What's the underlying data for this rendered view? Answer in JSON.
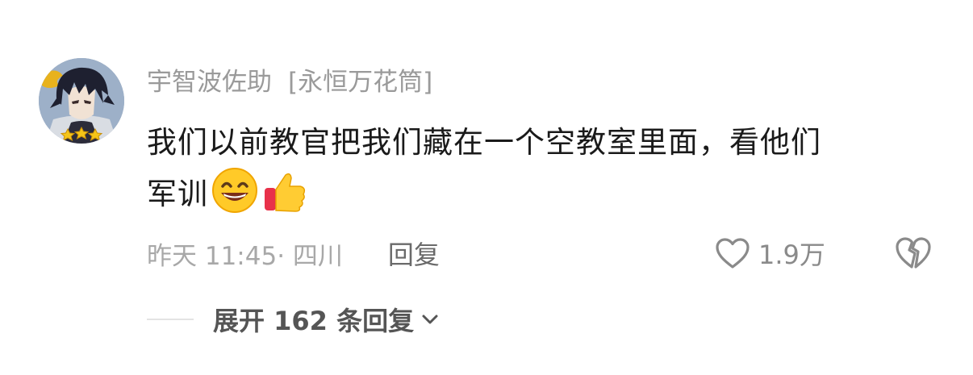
{
  "comment": {
    "username": "宇智波佐助",
    "badge": "[永恒万花筒]",
    "text_line1": "我们以前教官把我们藏在一个空教室里面，看他们",
    "text_line2": "军训",
    "emojis": [
      "grinning-face-emoji",
      "thumbs-up-emoji"
    ],
    "time_location": "昨天 11:45· 四川",
    "reply_label": "回复",
    "like_count": "1.9万",
    "expand_label": "展开 162 条回复"
  },
  "icons": {
    "like": "heart-outline-icon",
    "dislike": "broken-heart-icon",
    "expand": "chevron-down-icon"
  },
  "colors": {
    "username": "#9a9a9a",
    "text": "#1a1a1a",
    "meta": "#a8a8a8",
    "reply": "#6a6a6a"
  }
}
